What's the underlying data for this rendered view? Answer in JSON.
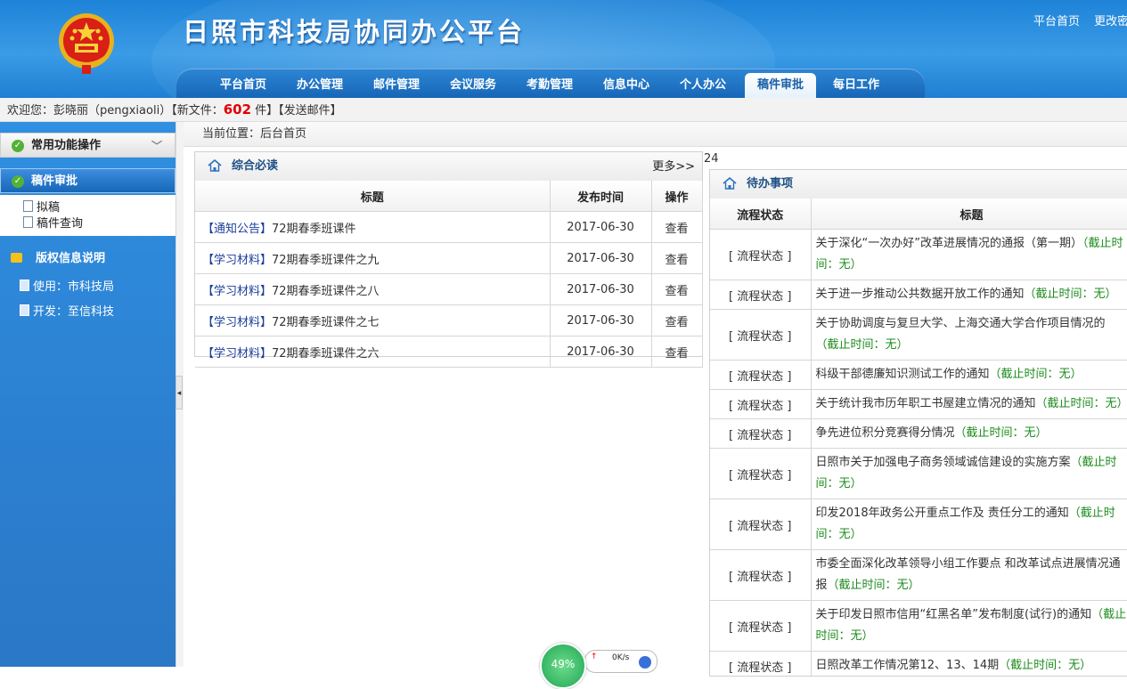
{
  "header": {
    "site_title": "日照市科技局协同办公平台",
    "top_links": [
      "平台首页",
      "更改密"
    ],
    "nav_tabs": [
      "平台首页",
      "办公管理",
      "邮件管理",
      "会议服务",
      "考勤管理",
      "信息中心",
      "个人办公",
      "稿件审批",
      "每日工作"
    ],
    "active_tab": "稿件审批"
  },
  "welcome": {
    "prefix": "欢迎您：彭晓丽（pengxiaoli）【新文件：",
    "file_count": "602",
    "suffix": " 件】【发送邮件】"
  },
  "sidebar": {
    "common_label": "常用功能操作",
    "review_label": "稿件审批",
    "sub_items": [
      "拟稿",
      "稿件查询"
    ],
    "copyright_label": "版权信息说明",
    "copyright_items": [
      "使用：市科技局",
      "开发：至信科技"
    ]
  },
  "breadcrumb": "当前位置：后台首页",
  "stray_text": "24",
  "left_panel": {
    "title": "综合必读",
    "more": "更多>>",
    "columns": [
      "标题",
      "发布时间",
      "操作"
    ],
    "rows": [
      {
        "category": "【通知公告】",
        "title": "72期春季班课件",
        "date": "2017-06-30",
        "action": "查看"
      },
      {
        "category": "【学习材料】",
        "title": "72期春季班课件之九",
        "date": "2017-06-30",
        "action": "查看"
      },
      {
        "category": "【学习材料】",
        "title": "72期春季班课件之八",
        "date": "2017-06-30",
        "action": "查看"
      },
      {
        "category": "【学习材料】",
        "title": "72期春季班课件之七",
        "date": "2017-06-30",
        "action": "查看"
      },
      {
        "category": "【学习材料】",
        "title": "72期春季班课件之六",
        "date": "2017-06-30",
        "action": "查看"
      }
    ]
  },
  "right_panel": {
    "title": "待办事项",
    "columns": [
      "流程状态",
      "标题"
    ],
    "status_label": "[ 流程状态 ]",
    "rows": [
      {
        "title": "关于深化“一次办好”改革进展情况的通报（第一期）",
        "deadline": "（截止时间：无）"
      },
      {
        "title": "关于进一步推动公共数据开放工作的通知",
        "deadline": "（截止时间：无）"
      },
      {
        "title": "关于协助调度与复旦大学、上海交通大学合作项目情况的",
        "deadline": "（截止时间：无）"
      },
      {
        "title": "科级干部德廉知识测试工作的通知",
        "deadline": "（截止时间：无）"
      },
      {
        "title": "关于统计我市历年职工书屋建立情况的通知",
        "deadline": "（截止时间：无）"
      },
      {
        "title": "争先进位积分竞赛得分情况",
        "deadline": "（截止时间：无）"
      },
      {
        "title": "日照市关于加强电子商务领域诚信建设的实施方案",
        "deadline": "（截止时间：无）"
      },
      {
        "title": "印发2018年政务公开重点工作及 责任分工的通知",
        "deadline": "（截止时间：无）"
      },
      {
        "title": "市委全面深化改革领导小组工作要点 和改革试点进展情况通报",
        "deadline": "（截止时间：无）"
      },
      {
        "title": "关于印发日照市信用“红黑名单”发布制度(试行)的通知",
        "deadline": "（截止时间：无）"
      },
      {
        "title": "日照改革工作情况第12、13、14期",
        "deadline": "（截止时间：无）"
      }
    ]
  },
  "widget": {
    "percent": "49%",
    "speed": "0K/s"
  }
}
